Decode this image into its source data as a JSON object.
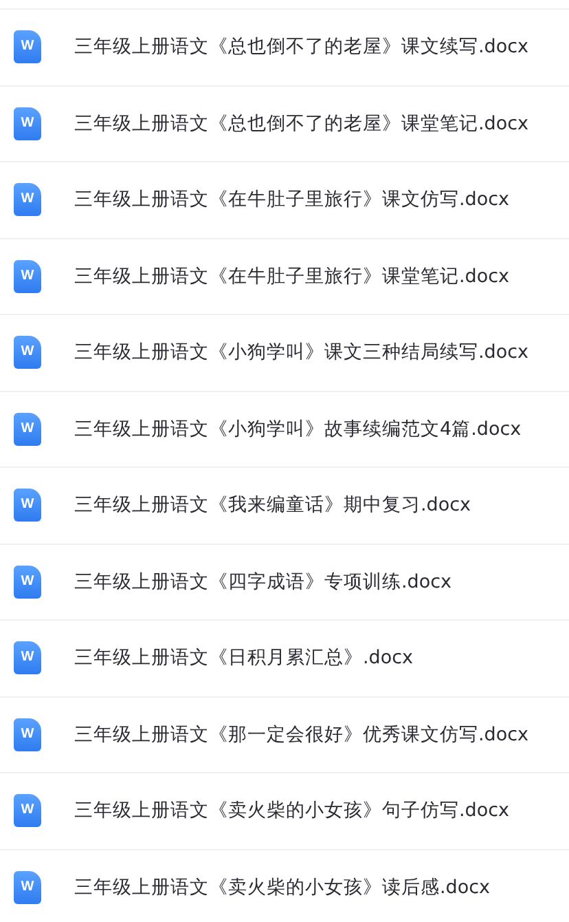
{
  "files": [
    {
      "icon_letter": "W",
      "name": "三年级上册语文《总也倒不了的老屋》课文续写.docx"
    },
    {
      "icon_letter": "W",
      "name": "三年级上册语文《总也倒不了的老屋》课堂笔记.docx"
    },
    {
      "icon_letter": "W",
      "name": "三年级上册语文《在牛肚子里旅行》课文仿写.docx"
    },
    {
      "icon_letter": "W",
      "name": "三年级上册语文《在牛肚子里旅行》课堂笔记.docx"
    },
    {
      "icon_letter": "W",
      "name": "三年级上册语文《小狗学叫》课文三种结局续写.docx"
    },
    {
      "icon_letter": "W",
      "name": "三年级上册语文《小狗学叫》故事续编范文4篇.docx"
    },
    {
      "icon_letter": "W",
      "name": "三年级上册语文《我来编童话》期中复习.docx"
    },
    {
      "icon_letter": "W",
      "name": "三年级上册语文《四字成语》专项训练.docx"
    },
    {
      "icon_letter": "W",
      "name": "三年级上册语文《日积月累汇总》.docx"
    },
    {
      "icon_letter": "W",
      "name": "三年级上册语文《那一定会很好》优秀课文仿写.docx"
    },
    {
      "icon_letter": "W",
      "name": "三年级上册语文《卖火柴的小女孩》句子仿写.docx"
    },
    {
      "icon_letter": "W",
      "name": "三年级上册语文《卖火柴的小女孩》读后感.docx"
    }
  ]
}
